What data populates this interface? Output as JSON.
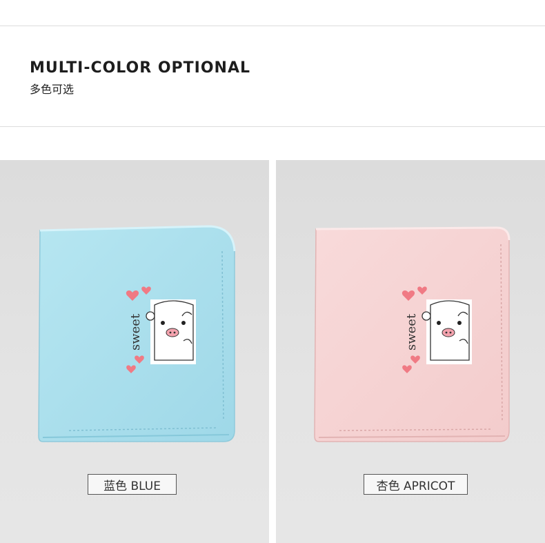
{
  "header": {
    "title": "MULTI-COLOR OPTIONAL",
    "subtitle": "多色可选"
  },
  "products": [
    {
      "label": "蓝色 BLUE",
      "color": "#a8dfec",
      "color_dark": "#86c8da",
      "print_text": "sweet"
    },
    {
      "label": "杏色 APRICOT",
      "color": "#f6d3d3",
      "color_dark": "#e7b9b9",
      "print_text": "sweet"
    }
  ],
  "colors": {
    "heart": "#f07a84",
    "pig_nose": "#f4a3ae"
  }
}
